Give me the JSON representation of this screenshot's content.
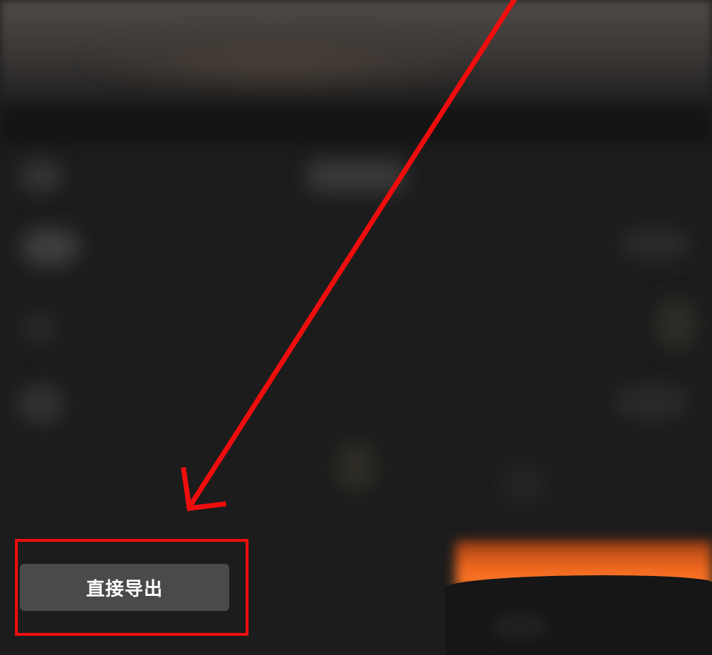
{
  "export": {
    "button_label": "直接导出"
  },
  "annotation": {
    "color": "#f00d0d"
  },
  "colors": {
    "background": "#1c1c1c",
    "button_bg": "#4a4a4a",
    "glow": "#f26a20"
  }
}
